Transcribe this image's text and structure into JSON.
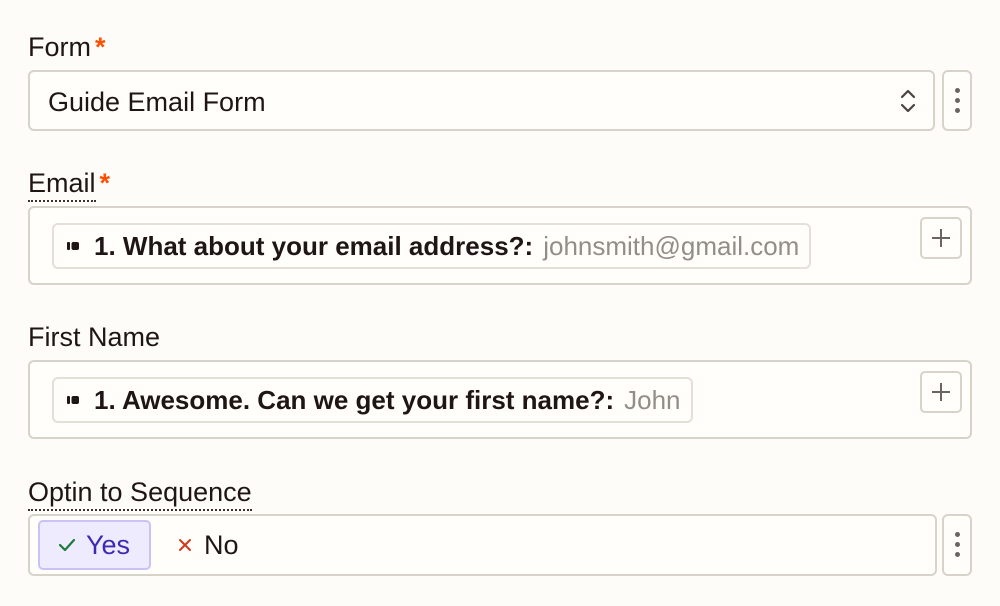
{
  "form_field": {
    "label": "Form",
    "required_mark": "*",
    "selected_value": "Guide Email Form"
  },
  "email_field": {
    "label": "Email",
    "required_mark": "*",
    "mapped_question": "1. What about your email address?:",
    "mapped_sample": "johnsmith@gmail.com"
  },
  "first_name_field": {
    "label": "First Name",
    "mapped_question": "1. Awesome. Can we get your first name?:",
    "mapped_sample": "John"
  },
  "optin_field": {
    "label": "Optin to Sequence",
    "options": [
      {
        "label": "Yes",
        "selected": true,
        "icon": "check-icon"
      },
      {
        "label": "No",
        "selected": false,
        "icon": "x-icon"
      }
    ]
  },
  "colors": {
    "required": "#ff4f00",
    "selected_text": "#3d2ab3",
    "selected_bg": "#eeebff",
    "check": "#1f7a3a",
    "x": "#d0391f"
  }
}
